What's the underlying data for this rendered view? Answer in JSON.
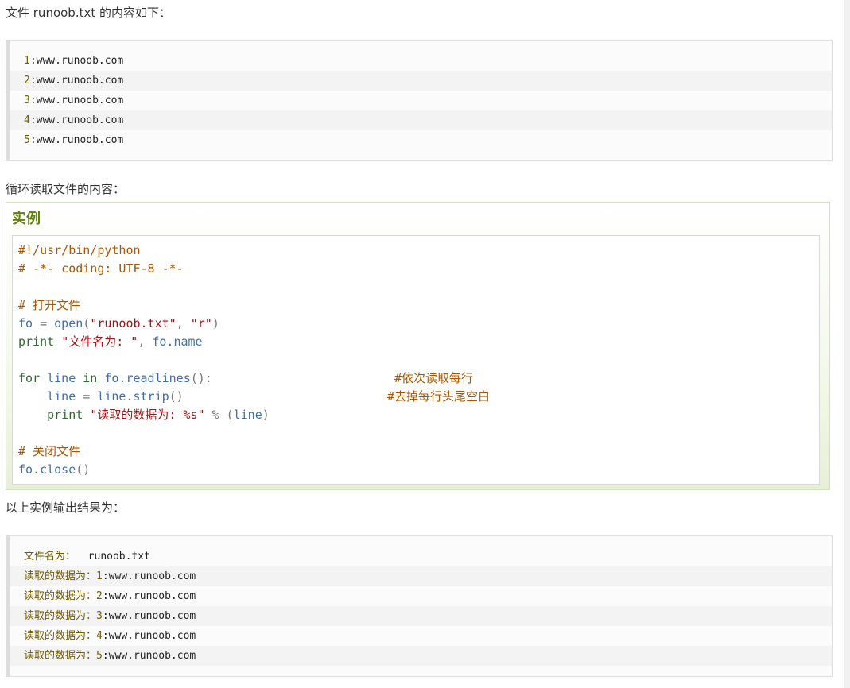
{
  "intro1": "文件 runoob.txt 的内容如下：",
  "file_lines": [
    {
      "num": "1",
      "text": ":www.runoob.com"
    },
    {
      "num": "2",
      "text": ":www.runoob.com"
    },
    {
      "num": "3",
      "text": ":www.runoob.com"
    },
    {
      "num": "4",
      "text": ":www.runoob.com"
    },
    {
      "num": "5",
      "text": ":www.runoob.com"
    }
  ],
  "intro2": "循环读取文件的内容：",
  "example": {
    "title": "实例",
    "code": {
      "l1": "#!/usr/bin/python",
      "l2": "# -*- coding: UTF-8 -*-",
      "l4": "# 打开文件",
      "l5_var": "fo",
      "l5_eq": " = ",
      "l5_fn": "open",
      "l5_p1": "(",
      "l5_s1": "\"runoob.txt\"",
      "l5_c": ", ",
      "l5_s2": "\"r\"",
      "l5_p2": ")",
      "l6_kw": "print",
      "l6_sp": " ",
      "l6_s": "\"文件名为: \"",
      "l6_c": ", ",
      "l6_id": "fo.name",
      "l8_kw1": "for",
      "l8_v": " line ",
      "l8_kw2": "in",
      "l8_call": " fo.readlines",
      "l8_end": "():",
      "l8_comment": "#依次读取每行",
      "l9_v": "line",
      "l9_eq": " = ",
      "l9_call": "line.strip",
      "l9_end": "()",
      "l9_comment": "#去掉每行头尾空白",
      "l10_kw": "print",
      "l10_sp": " ",
      "l10_s": "\"读取的数据为: %s\"",
      "l10_op": " % (",
      "l10_id": "line",
      "l10_end": ")",
      "l12": "# 关闭文件",
      "l13_call": "fo.close",
      "l13_end": "()"
    }
  },
  "intro3": "以上实例输出结果为：",
  "output": {
    "line0_label": "文件名为：",
    "line0_value": "  runoob.txt",
    "label": "读取的数据为：",
    "rows": [
      {
        "num": "1",
        "text": ":www.runoob.com"
      },
      {
        "num": "2",
        "text": ":www.runoob.com"
      },
      {
        "num": "3",
        "text": ":www.runoob.com"
      },
      {
        "num": "4",
        "text": ":www.runoob.com"
      },
      {
        "num": "5",
        "text": ":www.runoob.com"
      }
    ]
  }
}
